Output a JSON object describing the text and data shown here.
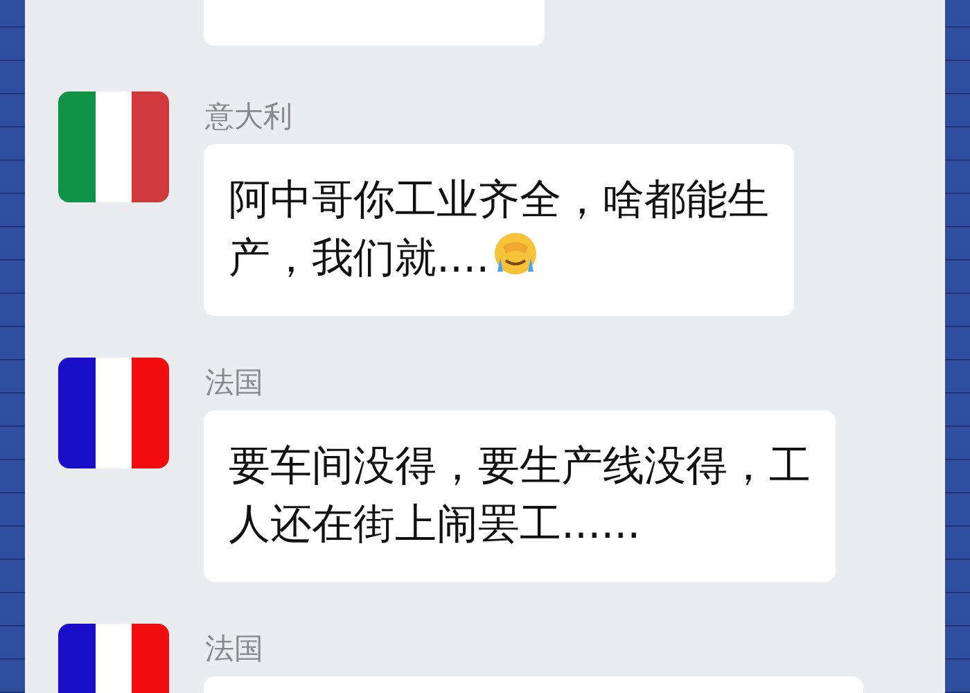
{
  "messages": [
    {
      "kind": "bubble_only"
    },
    {
      "kind": "full",
      "avatar": {
        "kind": "italy"
      },
      "sender": "意大利",
      "lines": [
        "阿中哥你工业齐全，啥都能生",
        "产，我们就...."
      ],
      "emoji": true
    },
    {
      "kind": "full",
      "avatar": {
        "kind": "france"
      },
      "sender": "法国",
      "lines": [
        "要车间没得，要生产线没得，工",
        "人还在街上闹罢工......"
      ]
    },
    {
      "kind": "full",
      "avatar": {
        "kind": "france"
      },
      "sender": "法国"
    }
  ]
}
